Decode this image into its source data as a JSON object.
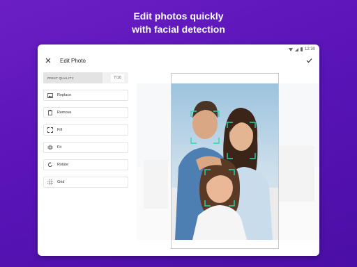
{
  "headline": {
    "line1": "Edit photos quickly",
    "line2": "with facial detection"
  },
  "status_bar": {
    "time": "12:30"
  },
  "app_bar": {
    "title": "Edit Photo"
  },
  "print_quality": {
    "label": "PRINT QUALITY",
    "value": "7/10",
    "level": 0.7
  },
  "tools": [
    {
      "label": "Replace",
      "icon": "image-icon"
    },
    {
      "label": "Remove",
      "icon": "trash-icon"
    },
    {
      "label": "Fill",
      "icon": "expand-icon"
    },
    {
      "label": "Fit",
      "icon": "compress-icon"
    },
    {
      "label": "Rotate",
      "icon": "rotate-icon"
    },
    {
      "label": "Grid",
      "icon": "grid-icon"
    }
  ],
  "colors": {
    "background": "#5a14b8",
    "face_frame": "#29d6b0"
  }
}
